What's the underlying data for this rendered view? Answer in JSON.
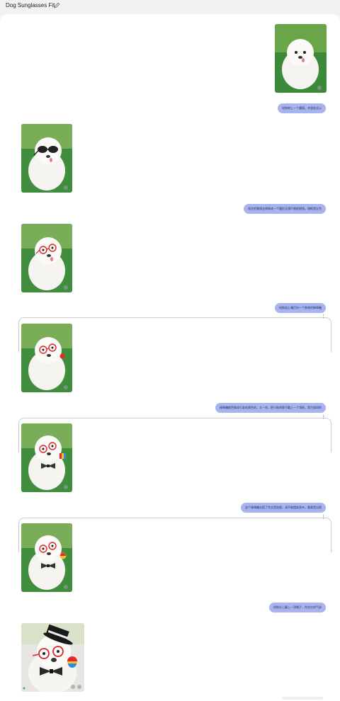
{
  "header": {
    "title": "Dog Sunglasses Fit",
    "edit_icon": "pencil-icon"
  },
  "messages": [
    {
      "role": "user",
      "type": "image",
      "description": "white puppy on grass"
    },
    {
      "role": "user",
      "type": "text",
      "text": "给狗带上一个墨镜，并居处显示"
    },
    {
      "role": "model",
      "type": "image"
    },
    {
      "role": "user",
      "type": "text",
      "text": "现在把墨镜去掉换成一个圆形无镜片细框眼镜，镜框是红色"
    },
    {
      "role": "model",
      "type": "image"
    },
    {
      "role": "user",
      "type": "text",
      "text": "给狗加上嘴巴叼一个鲜艳的棒棒糖"
    },
    {
      "role": "model",
      "type": "image"
    },
    {
      "role": "user",
      "type": "text",
      "text": "棒棒糖颜色换成七彩虹颜色的，大一些，把小狗的脖子戴上一个领结，黑白相间的"
    },
    {
      "role": "model",
      "type": "image"
    },
    {
      "role": "user",
      "type": "text",
      "text": "这个棒棒糖太假了完全是贴图，请不能摆放表布，重要是自然"
    },
    {
      "role": "model",
      "type": "image"
    },
    {
      "role": "user",
      "type": "text",
      "text": "给狗头上戴上一顶帽子，符合它的气质"
    },
    {
      "role": "model",
      "type": "image"
    }
  ],
  "colors": {
    "bubble": "#a9b4ef",
    "background": "#f1f2f4",
    "panel": "#ffffff"
  }
}
